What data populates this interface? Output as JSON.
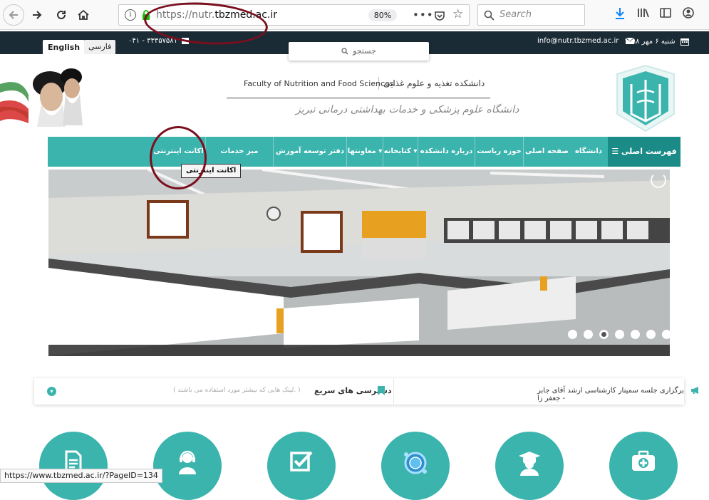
{
  "browser": {
    "url_prefix": "https://nutr.",
    "url_domain": "tbzmed.ac.ir",
    "zoom": "80%",
    "search_placeholder": "Search",
    "status_url": "https://www.tbzmed.ac.ir/?PageID=134"
  },
  "topbar": {
    "lang_en": "English",
    "lang_fa": "فارسی",
    "phone": "۰۴۱ - ۳۳۳۵۷۵۸۱",
    "email": "info@nutr.tbzmed.ac.ir",
    "date": "شنبه ۶ مهر ۱۳۹۸",
    "search_placeholder": "جستجو"
  },
  "header": {
    "title_fa": "دانشکده تغذیه و علوم غذایی",
    "title_en": "Faculty of Nutrition and Food Sciences",
    "university_fa": "دانشگاه علوم پزشکی و خدمات بهداشتی درمانی تبریز"
  },
  "nav": {
    "main_menu": "فهرست اصلی",
    "items": [
      "دانشگاه",
      "صفحه اصلی",
      "حوزه ریاست",
      "درباره دانشکده",
      "کتابخانه",
      "معاونتها",
      "دفتر توسعه آموزش",
      "میز خدمات الکترونیکی",
      "اکانت اینترنتی"
    ],
    "tooltip": "اکانت اینترنتی"
  },
  "slider": {
    "slide_count": 7,
    "active_index": 2
  },
  "quickbar": {
    "news": "برگزاری جلسه سمینار کارشناسی ارشد آقای جابر جعفر زا -",
    "title": "دسترسی های سریع",
    "subtitle": "( لینک هایی که بیشتر مورد استفاده می باشند. )"
  },
  "colors": {
    "teal": "#3cb4ae",
    "teal_dark": "#1b8b88",
    "topbar": "#1b2b35",
    "annotation": "#7a0f1e"
  },
  "circles": [
    "document-icon",
    "support-agent-icon",
    "checkbox-icon",
    "globe-icon",
    "graduate-icon",
    "medical-kit-icon"
  ]
}
